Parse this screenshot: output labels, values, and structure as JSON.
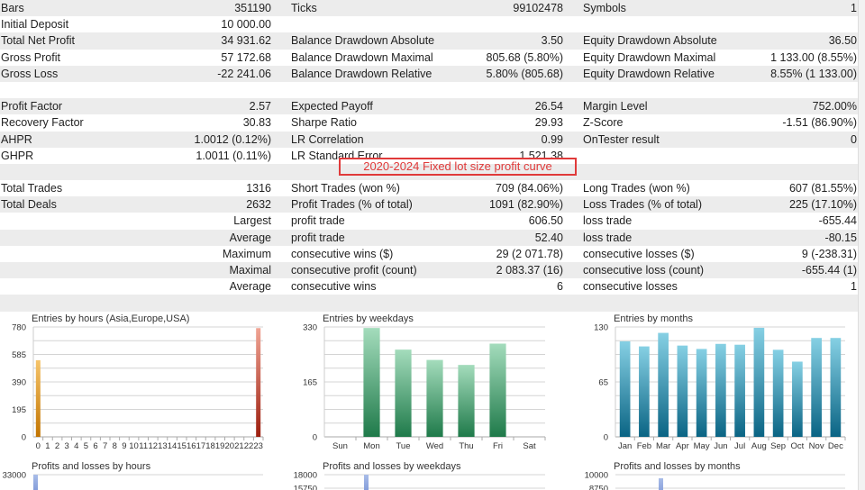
{
  "report": {
    "rows": [
      [
        "Bars",
        "351190",
        "Ticks",
        "99102478",
        "Symbols",
        "1"
      ],
      [
        "Initial Deposit",
        "10 000.00",
        "",
        "",
        "",
        ""
      ],
      [
        "Total Net Profit",
        "34 931.62",
        "Balance Drawdown Absolute",
        "3.50",
        "Equity Drawdown Absolute",
        "36.50"
      ],
      [
        "Gross Profit",
        "57 172.68",
        "Balance Drawdown Maximal",
        "805.68 (5.80%)",
        "Equity Drawdown Maximal",
        "1 133.00 (8.55%)"
      ],
      [
        "Gross Loss",
        "-22 241.06",
        "Balance Drawdown Relative",
        "5.80% (805.68)",
        "Equity Drawdown Relative",
        "8.55% (1 133.00)"
      ],
      [
        "",
        "",
        "",
        "",
        "",
        ""
      ],
      [
        "Profit Factor",
        "2.57",
        "Expected Payoff",
        "26.54",
        "Margin Level",
        "752.00%"
      ],
      [
        "Recovery Factor",
        "30.83",
        "Sharpe Ratio",
        "29.93",
        "Z-Score",
        "-1.51 (86.90%)"
      ],
      [
        "AHPR",
        "1.0012 (0.12%)",
        "LR Correlation",
        "0.99",
        "OnTester result",
        "0"
      ],
      [
        "GHPR",
        "1.0011 (0.11%)",
        "LR Standard Error",
        "1 521.38",
        "",
        ""
      ],
      [
        "",
        "",
        "",
        "",
        "",
        ""
      ],
      [
        "Total Trades",
        "1316",
        "Short Trades (won %)",
        "709 (84.06%)",
        "Long Trades (won %)",
        "607 (81.55%)"
      ],
      [
        "Total Deals",
        "2632",
        "Profit Trades (% of total)",
        "1091 (82.90%)",
        "Loss Trades (% of total)",
        "225 (17.10%)"
      ],
      [
        "",
        "Largest",
        "profit trade",
        "606.50",
        "loss trade",
        "-655.44"
      ],
      [
        "",
        "Average",
        "profit trade",
        "52.40",
        "loss trade",
        "-80.15"
      ],
      [
        "",
        "Maximum",
        "consecutive wins ($)",
        "29 (2 071.78)",
        "consecutive losses ($)",
        "9 (-238.31)"
      ],
      [
        "",
        "Maximal",
        "consecutive profit (count)",
        "2 083.37 (16)",
        "consecutive loss (count)",
        "-655.44 (1)"
      ],
      [
        "",
        "Average",
        "consecutive wins",
        "6",
        "consecutive losses",
        "1"
      ],
      [
        "",
        "",
        "",
        "",
        "",
        ""
      ]
    ],
    "annotation": "2020-2024 Fixed lot size profit curve",
    "annotation_color": "#e03a3a"
  },
  "chart_data": [
    {
      "type": "bar",
      "title": "Entries by hours (Asia,Europe,USA)",
      "categories": [
        "0",
        "1",
        "2",
        "3",
        "4",
        "5",
        "6",
        "7",
        "8",
        "9",
        "10",
        "11",
        "12",
        "13",
        "14",
        "15",
        "16",
        "17",
        "18",
        "19",
        "20",
        "21",
        "22",
        "23"
      ],
      "values": [
        544,
        0,
        0,
        0,
        0,
        0,
        0,
        0,
        0,
        0,
        0,
        0,
        0,
        0,
        0,
        0,
        0,
        0,
        0,
        0,
        0,
        0,
        0,
        772
      ],
      "yticks": [
        "0",
        "195",
        "390",
        "585",
        "780"
      ],
      "ylim": [
        0,
        780
      ],
      "grid": true,
      "colors": {
        "asia": "#d98a1a",
        "usa": "#b83a25"
      }
    },
    {
      "type": "bar",
      "title": "Entries by weekdays",
      "categories": [
        "Sun",
        "Mon",
        "Tue",
        "Wed",
        "Thu",
        "Fri",
        "Sat"
      ],
      "values": [
        0,
        327,
        262,
        231,
        216,
        280,
        0
      ],
      "yticks": [
        "0",
        "165",
        "330"
      ],
      "ylim": [
        0,
        330
      ],
      "grid": true,
      "colors": {
        "bar": "#2e8a5a"
      }
    },
    {
      "type": "bar",
      "title": "Entries by months",
      "categories": [
        "Jan",
        "Feb",
        "Mar",
        "Apr",
        "May",
        "Jun",
        "Jul",
        "Aug",
        "Sep",
        "Oct",
        "Nov",
        "Dec"
      ],
      "values": [
        113,
        107,
        123,
        108,
        104,
        110,
        109,
        129,
        103,
        89,
        117,
        117
      ],
      "yticks": [
        "0",
        "65",
        "130"
      ],
      "ylim": [
        0,
        130
      ],
      "grid": true,
      "colors": {
        "bar": "#1a7fa0"
      }
    },
    {
      "type": "bar",
      "title": "Profits and losses by hours",
      "yticks": [
        "33000"
      ],
      "colors": {
        "bar": "#8fa8e0"
      }
    },
    {
      "type": "bar",
      "title": "Profits and losses by weekdays",
      "yticks": [
        "18000",
        "15750"
      ],
      "colors": {
        "bar": "#8fa8e0"
      }
    },
    {
      "type": "bar",
      "title": "Profits and losses by months",
      "yticks": [
        "10000",
        "8750"
      ],
      "colors": {
        "bar": "#8fa8e0"
      }
    }
  ]
}
